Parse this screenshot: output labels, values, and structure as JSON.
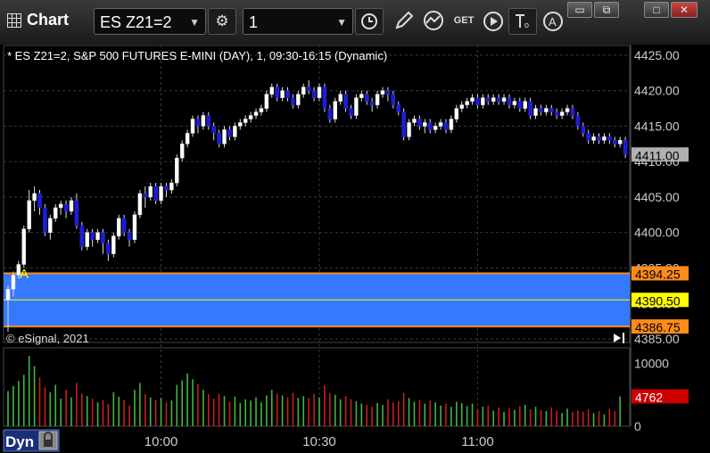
{
  "window": {
    "title": "Chart",
    "icon": "chart-grid-icon"
  },
  "toolbar": {
    "symbol": "ES Z21=2",
    "interval": "1",
    "symbol_icon": "gear-icon",
    "interval_icon": "clock-icon",
    "tools": [
      "pencil-icon",
      "study-icon",
      "get-icon",
      "play-icon",
      "text-format-icon",
      "alert-icon"
    ],
    "window_buttons": [
      "restore-icon",
      "resize-icon",
      "maximize-icon",
      "close-icon"
    ]
  },
  "chart_header": "* ES Z21=2, S&P 500 FUTURES E-MINI (DAY), 1, 09:30-16:15 (Dynamic)",
  "copyright": "© eSignal, 2021",
  "bottom_bar": {
    "dyn_label": "Dyn",
    "lock_icon": "lock-icon"
  },
  "marker_label": "A",
  "colors": {
    "up": "#ffffff",
    "down": "#1c1cd8",
    "zone": "#3579ff",
    "zone_border": "#ff8c1a",
    "last_price_bg": "#b0b0b0",
    "mid_line": "#ffff00",
    "vol_up": "#3fb83f",
    "vol_down": "#c81e1e",
    "grid": "#3a3a3a"
  },
  "chart_data": {
    "type": "candlestick",
    "symbol": "ES Z21=2",
    "x_ticks": [
      "10:00",
      "10:30",
      "11:00"
    ],
    "y_ticks": [
      "4425.00",
      "4420.00",
      "4415.00",
      "4410.00",
      "4405.00",
      "4400.00",
      "4395.00",
      "4390.00",
      "4385.00"
    ],
    "ylim": [
      4384.5,
      4426.5
    ],
    "last_price": "4411.00",
    "zone": {
      "upper": "4394.25",
      "mid": "4390.50",
      "lower": "4386.75"
    },
    "start_time": "09:31",
    "candles": [
      [
        4390.5,
        4392.0,
        4386.0,
        4392.5
      ],
      [
        4392.0,
        4394.0,
        4391.0,
        4394.5
      ],
      [
        4394.0,
        4395.5,
        4393.5,
        4396.0
      ],
      [
        4395.5,
        4400.5,
        4395.0,
        4401.0
      ],
      [
        4400.5,
        4404.5,
        4400.0,
        4406.0
      ],
      [
        4404.5,
        4405.5,
        4403.0,
        4406.5
      ],
      [
        4405.5,
        4403.5,
        4402.5,
        4406.0
      ],
      [
        4403.5,
        4400.0,
        4399.5,
        4404.0
      ],
      [
        4400.0,
        4402.0,
        4399.0,
        4402.5
      ],
      [
        4402.0,
        4403.5,
        4401.5,
        4404.0
      ],
      [
        4403.5,
        4404.0,
        4402.5,
        4404.5
      ],
      [
        4404.0,
        4403.0,
        4402.0,
        4404.5
      ],
      [
        4403.0,
        4404.5,
        4402.5,
        4405.0
      ],
      [
        4404.5,
        4401.0,
        4400.5,
        4405.5
      ],
      [
        4401.0,
        4398.0,
        4397.5,
        4401.5
      ],
      [
        4398.0,
        4400.0,
        4397.5,
        4400.5
      ],
      [
        4400.0,
        4399.0,
        4398.0,
        4400.5
      ],
      [
        4399.0,
        4400.0,
        4398.5,
        4400.5
      ],
      [
        4400.0,
        4398.5,
        4397.0,
        4400.5
      ],
      [
        4398.5,
        4397.0,
        4396.0,
        4399.0
      ],
      [
        4397.0,
        4399.5,
        4396.5,
        4400.0
      ],
      [
        4399.5,
        4402.0,
        4399.0,
        4402.5
      ],
      [
        4402.0,
        4400.0,
        4399.5,
        4402.5
      ],
      [
        4400.0,
        4399.0,
        4398.0,
        4400.5
      ],
      [
        4399.0,
        4402.5,
        4398.5,
        4403.0
      ],
      [
        4402.5,
        4405.5,
        4402.0,
        4406.0
      ],
      [
        4405.5,
        4405.0,
        4403.5,
        4406.5
      ],
      [
        4405.0,
        4406.5,
        4404.5,
        4407.0
      ],
      [
        4406.5,
        4404.5,
        4404.0,
        4407.0
      ],
      [
        4404.5,
        4406.5,
        4404.0,
        4407.0
      ],
      [
        4406.5,
        4406.0,
        4405.0,
        4407.0
      ],
      [
        4406.0,
        4407.0,
        4405.5,
        4407.5
      ],
      [
        4407.0,
        4410.5,
        4406.5,
        4411.0
      ],
      [
        4410.5,
        4412.5,
        4410.0,
        4413.0
      ],
      [
        4412.5,
        4414.0,
        4412.0,
        4414.5
      ],
      [
        4414.0,
        4416.0,
        4413.5,
        4416.5
      ],
      [
        4416.0,
        4415.0,
        4414.0,
        4416.5
      ],
      [
        4415.0,
        4416.5,
        4414.5,
        4417.0
      ],
      [
        4416.5,
        4415.0,
        4414.5,
        4417.0
      ],
      [
        4415.0,
        4414.0,
        4413.0,
        4415.5
      ],
      [
        4414.0,
        4412.5,
        4412.0,
        4414.5
      ],
      [
        4412.5,
        4414.5,
        4412.0,
        4415.0
      ],
      [
        4414.5,
        4413.5,
        4413.0,
        4415.0
      ],
      [
        4413.5,
        4415.0,
        4413.0,
        4415.5
      ],
      [
        4415.0,
        4415.5,
        4414.5,
        4416.0
      ],
      [
        4415.5,
        4416.0,
        4415.0,
        4416.5
      ],
      [
        4416.0,
        4416.5,
        4415.5,
        4417.0
      ],
      [
        4416.5,
        4417.0,
        4416.0,
        4417.5
      ],
      [
        4417.0,
        4417.5,
        4416.5,
        4418.0
      ],
      [
        4417.5,
        4419.5,
        4417.0,
        4420.0
      ],
      [
        4419.5,
        4420.5,
        4419.0,
        4421.0
      ],
      [
        4420.5,
        4419.0,
        4418.5,
        4421.0
      ],
      [
        4419.0,
        4420.0,
        4418.5,
        4420.5
      ],
      [
        4420.0,
        4419.0,
        4418.5,
        4420.5
      ],
      [
        4419.0,
        4418.0,
        4417.5,
        4419.5
      ],
      [
        4418.0,
        4419.5,
        4417.5,
        4420.0
      ],
      [
        4419.5,
        4420.5,
        4419.0,
        4421.0
      ],
      [
        4420.5,
        4420.0,
        4419.5,
        4421.5
      ],
      [
        4420.0,
        4419.0,
        4418.5,
        4420.5
      ],
      [
        4419.0,
        4420.5,
        4418.5,
        4421.0
      ],
      [
        4420.5,
        4417.5,
        4417.0,
        4421.0
      ],
      [
        4417.5,
        4416.0,
        4415.5,
        4418.0
      ],
      [
        4416.0,
        4418.5,
        4415.5,
        4419.0
      ],
      [
        4418.5,
        4419.5,
        4418.0,
        4420.0
      ],
      [
        4419.5,
        4417.5,
        4417.0,
        4420.0
      ],
      [
        4417.5,
        4416.5,
        4416.0,
        4418.0
      ],
      [
        4416.5,
        4419.0,
        4416.0,
        4419.5
      ],
      [
        4419.0,
        4419.5,
        4418.5,
        4420.0
      ],
      [
        4419.5,
        4418.5,
        4418.0,
        4420.0
      ],
      [
        4418.5,
        4418.0,
        4417.0,
        4419.0
      ],
      [
        4418.0,
        4419.5,
        4417.5,
        4420.0
      ],
      [
        4419.5,
        4420.0,
        4419.0,
        4420.5
      ],
      [
        4420.0,
        4419.5,
        4418.5,
        4420.5
      ],
      [
        4419.5,
        4418.0,
        4417.5,
        4420.0
      ],
      [
        4418.0,
        4417.0,
        4416.5,
        4418.5
      ],
      [
        4417.0,
        4413.5,
        4413.0,
        4417.5
      ],
      [
        4413.5,
        4415.5,
        4413.0,
        4416.0
      ],
      [
        4415.5,
        4416.0,
        4415.0,
        4416.5
      ],
      [
        4416.0,
        4415.0,
        4414.5,
        4416.5
      ],
      [
        4415.0,
        4415.5,
        4414.0,
        4416.0
      ],
      [
        4415.5,
        4414.5,
        4414.0,
        4416.0
      ],
      [
        4414.5,
        4415.0,
        4414.0,
        4415.5
      ],
      [
        4415.0,
        4415.5,
        4414.5,
        4416.0
      ],
      [
        4415.5,
        4414.5,
        4414.0,
        4416.0
      ],
      [
        4414.5,
        4416.0,
        4414.0,
        4416.5
      ],
      [
        4416.0,
        4417.5,
        4415.5,
        4418.0
      ],
      [
        4417.5,
        4418.0,
        4417.0,
        4418.5
      ],
      [
        4418.0,
        4418.5,
        4417.5,
        4419.0
      ],
      [
        4418.5,
        4419.0,
        4418.0,
        4419.5
      ],
      [
        4419.0,
        4418.0,
        4417.5,
        4419.5
      ],
      [
        4418.0,
        4419.0,
        4417.5,
        4419.5
      ],
      [
        4419.0,
        4418.5,
        4418.0,
        4419.5
      ],
      [
        4418.5,
        4419.0,
        4418.0,
        4419.5
      ],
      [
        4419.0,
        4418.5,
        4418.0,
        4419.5
      ],
      [
        4418.5,
        4419.0,
        4418.0,
        4419.5
      ],
      [
        4419.0,
        4418.0,
        4417.5,
        4419.5
      ],
      [
        4418.0,
        4418.5,
        4417.5,
        4419.0
      ],
      [
        4418.5,
        4417.5,
        4417.0,
        4419.0
      ],
      [
        4417.5,
        4418.5,
        4417.0,
        4419.0
      ],
      [
        4418.5,
        4416.5,
        4416.0,
        4419.0
      ],
      [
        4416.5,
        4417.5,
        4416.0,
        4418.0
      ],
      [
        4417.5,
        4417.0,
        4416.5,
        4418.0
      ],
      [
        4417.0,
        4417.5,
        4416.5,
        4418.0
      ],
      [
        4417.5,
        4417.0,
        4416.5,
        4418.0
      ],
      [
        4417.0,
        4416.5,
        4416.0,
        4417.5
      ],
      [
        4416.5,
        4417.0,
        4416.0,
        4417.5
      ],
      [
        4417.0,
        4417.5,
        4416.5,
        4418.0
      ],
      [
        4417.5,
        4416.5,
        4416.0,
        4418.0
      ],
      [
        4416.5,
        4415.0,
        4414.5,
        4417.0
      ],
      [
        4415.0,
        4414.0,
        4413.5,
        4415.5
      ],
      [
        4414.0,
        4413.0,
        4412.5,
        4414.5
      ],
      [
        4413.0,
        4413.5,
        4412.5,
        4414.0
      ],
      [
        4413.5,
        4413.0,
        4412.5,
        4414.0
      ],
      [
        4413.0,
        4413.5,
        4412.5,
        4414.0
      ],
      [
        4413.5,
        4413.0,
        4412.5,
        4414.0
      ],
      [
        4413.0,
        4412.5,
        4412.0,
        4413.5
      ],
      [
        4412.5,
        4413.0,
        4412.0,
        4413.5
      ],
      [
        4413.0,
        4411.0,
        4410.5,
        4413.5
      ]
    ],
    "volume_ticks": [
      "10000",
      "5000",
      "0"
    ],
    "volume_ylim": [
      0,
      12500
    ],
    "last_volume": "4762",
    "volume": [
      5600,
      6400,
      7200,
      8200,
      11200,
      9600,
      7800,
      6200,
      5400,
      6600,
      4400,
      5800,
      4600,
      6900,
      5200,
      4800,
      4400,
      3800,
      4200,
      3600,
      5400,
      4700,
      4200,
      3300,
      5800,
      6900,
      5100,
      4600,
      4200,
      4500,
      3800,
      4100,
      6600,
      7300,
      8400,
      7500,
      6700,
      5800,
      5100,
      4400,
      5200,
      4800,
      3900,
      4700,
      3700,
      4300,
      4100,
      4600,
      3800,
      4900,
      5800,
      5200,
      4900,
      4600,
      5300,
      4500,
      4800,
      4500,
      5200,
      4600,
      6500,
      5300,
      5000,
      4300,
      4800,
      4300,
      4000,
      3600,
      3400,
      3100,
      3700,
      3400,
      4300,
      3800,
      4000,
      5300,
      4500,
      3900,
      4200,
      3600,
      4100,
      3800,
      3300,
      3600,
      3100,
      3900,
      3700,
      3200,
      3600,
      2700,
      3100,
      3300,
      2500,
      3000,
      2300,
      2900,
      2600,
      3200,
      3400,
      2700,
      3100,
      2600,
      2400,
      3000,
      2500,
      2100,
      2800,
      2300,
      2500,
      2300,
      2700,
      2100,
      2400,
      1900,
      2800,
      2400,
      4762
    ]
  }
}
